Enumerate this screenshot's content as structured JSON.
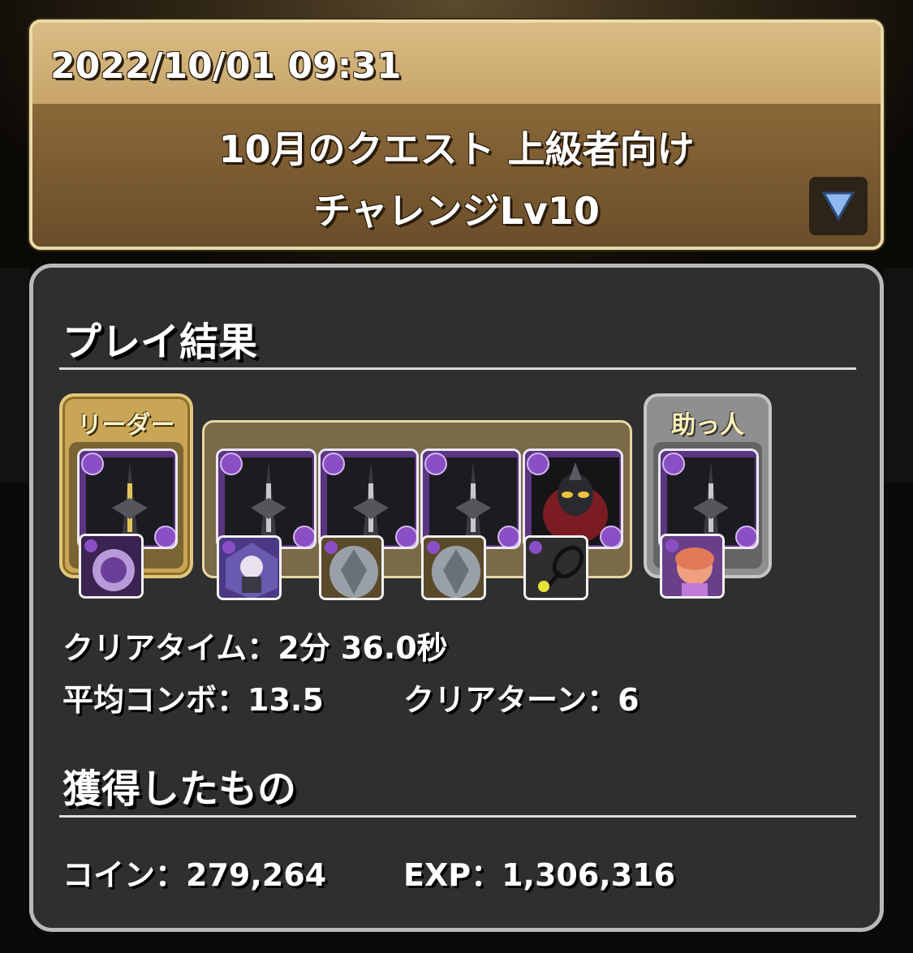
{
  "header": {
    "date": "2022/10/01 09:31",
    "quest_line1": "10月のクエスト 上級者向け",
    "quest_line2": "チャレンジLv10",
    "expand_icon": "triangle-down-icon"
  },
  "results": {
    "title": "プレイ結果",
    "leader_label": "リーダー",
    "helper_label": "助っ人",
    "clear_time_label": "クリアタイム：",
    "clear_time_value": "2分 36.0秒",
    "avg_combo_label": "平均コンボ：",
    "avg_combo_value": "13.5",
    "clear_turn_label": "クリアターン：",
    "clear_turn_value": "6"
  },
  "rewards": {
    "title": "獲得したもの",
    "coin_label": "コイン：",
    "coin_value": "279,264",
    "exp_label": "EXP：",
    "exp_value": "1,306,316"
  },
  "colors": {
    "frame_gold": "#e9dcaa",
    "panel_bg": "#2f2f2f",
    "attr_dark_purple": "#6b3f98"
  }
}
